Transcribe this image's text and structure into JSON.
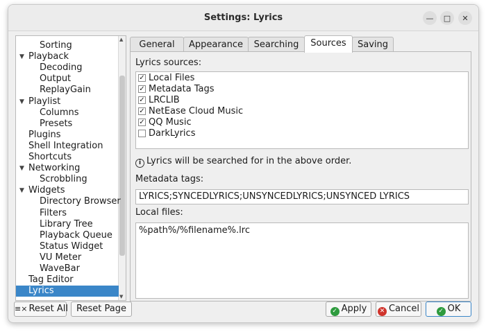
{
  "window": {
    "title": "Settings: Lyrics"
  },
  "sidebar": {
    "items": [
      {
        "label": "Sorting",
        "level": 1
      },
      {
        "label": "Playback",
        "level": 0,
        "expanded": true
      },
      {
        "label": "Decoding",
        "level": 1
      },
      {
        "label": "Output",
        "level": 1
      },
      {
        "label": "ReplayGain",
        "level": 1
      },
      {
        "label": "Playlist",
        "level": 0,
        "expanded": true
      },
      {
        "label": "Columns",
        "level": 1
      },
      {
        "label": "Presets",
        "level": 1
      },
      {
        "label": "Plugins",
        "level": 0
      },
      {
        "label": "Shell Integration",
        "level": 0
      },
      {
        "label": "Shortcuts",
        "level": 0
      },
      {
        "label": "Networking",
        "level": 0,
        "expanded": true
      },
      {
        "label": "Scrobbling",
        "level": 1
      },
      {
        "label": "Widgets",
        "level": 0,
        "expanded": true
      },
      {
        "label": "Directory Browser",
        "level": 1
      },
      {
        "label": "Filters",
        "level": 1
      },
      {
        "label": "Library Tree",
        "level": 1
      },
      {
        "label": "Playback Queue",
        "level": 1
      },
      {
        "label": "Status Widget",
        "level": 1
      },
      {
        "label": "VU Meter",
        "level": 1
      },
      {
        "label": "WaveBar",
        "level": 1
      },
      {
        "label": "Tag Editor",
        "level": 0
      },
      {
        "label": "Lyrics",
        "level": 0,
        "selected": true
      }
    ]
  },
  "tabs": [
    {
      "label": "General"
    },
    {
      "label": "Appearance"
    },
    {
      "label": "Searching"
    },
    {
      "label": "Sources",
      "active": true
    },
    {
      "label": "Saving"
    }
  ],
  "sources": {
    "label": "Lyrics sources:",
    "items": [
      {
        "label": "Local Files",
        "checked": true
      },
      {
        "label": "Metadata Tags",
        "checked": true
      },
      {
        "label": "LRCLIB",
        "checked": true
      },
      {
        "label": "NetEase Cloud Music",
        "checked": true
      },
      {
        "label": "QQ Music",
        "checked": true
      },
      {
        "label": "DarkLyrics",
        "checked": false
      }
    ],
    "info": "Lyrics will be searched for in the above order."
  },
  "metadata_tags": {
    "label": "Metadata tags:",
    "value": "LYRICS;SYNCEDLYRICS;UNSYNCEDLYRICS;UNSYNCED LYRICS"
  },
  "local_files": {
    "label": "Local files:",
    "value": "%path%/%filename%.lrc"
  },
  "buttons": {
    "reset_all": "Reset All",
    "reset_page": "Reset Page",
    "apply": "Apply",
    "cancel": "Cancel",
    "ok": "OK"
  },
  "colors": {
    "selection": "#3a86c8",
    "ok_icon": "#2e9b3e",
    "cancel_icon": "#d0342c"
  }
}
